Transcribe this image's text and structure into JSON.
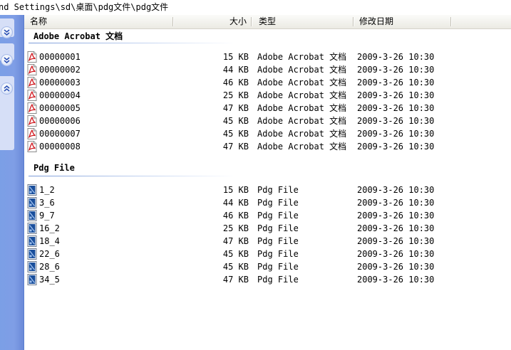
{
  "address": {
    "path": "nd Settings\\sd\\桌面\\pdg文件\\pdg文件"
  },
  "columns": {
    "name": "名称",
    "size": "大小",
    "type": "类型",
    "modified": "修改日期"
  },
  "colors": {
    "sidebar": "#7f9ee6",
    "pdf_icon": "#d0181e",
    "pdg_icon": "#1a4f9c",
    "group_line": "#7a9ad8"
  },
  "groups": [
    {
      "title": "Adobe Acrobat 文档",
      "icon": "pdf-file-icon",
      "files": [
        {
          "name": "00000001",
          "size": "15 KB",
          "type": "Adobe Acrobat 文档",
          "date": "2009-3-26 10:30"
        },
        {
          "name": "00000002",
          "size": "44 KB",
          "type": "Adobe Acrobat 文档",
          "date": "2009-3-26 10:30"
        },
        {
          "name": "00000003",
          "size": "46 KB",
          "type": "Adobe Acrobat 文档",
          "date": "2009-3-26 10:30"
        },
        {
          "name": "00000004",
          "size": "25 KB",
          "type": "Adobe Acrobat 文档",
          "date": "2009-3-26 10:30"
        },
        {
          "name": "00000005",
          "size": "47 KB",
          "type": "Adobe Acrobat 文档",
          "date": "2009-3-26 10:30"
        },
        {
          "name": "00000006",
          "size": "45 KB",
          "type": "Adobe Acrobat 文档",
          "date": "2009-3-26 10:30"
        },
        {
          "name": "00000007",
          "size": "45 KB",
          "type": "Adobe Acrobat 文档",
          "date": "2009-3-26 10:30"
        },
        {
          "name": "00000008",
          "size": "47 KB",
          "type": "Adobe Acrobat 文档",
          "date": "2009-3-26 10:30"
        }
      ]
    },
    {
      "title": "Pdg File",
      "icon": "pdg-file-icon",
      "files": [
        {
          "name": "1_2",
          "size": "15 KB",
          "type": "Pdg File",
          "date": "2009-3-26 10:30"
        },
        {
          "name": "3_6",
          "size": "44 KB",
          "type": "Pdg File",
          "date": "2009-3-26 10:30"
        },
        {
          "name": "9_7",
          "size": "46 KB",
          "type": "Pdg File",
          "date": "2009-3-26 10:30"
        },
        {
          "name": "16_2",
          "size": "25 KB",
          "type": "Pdg File",
          "date": "2009-3-26 10:30"
        },
        {
          "name": "18_4",
          "size": "47 KB",
          "type": "Pdg File",
          "date": "2009-3-26 10:30"
        },
        {
          "name": "22_6",
          "size": "45 KB",
          "type": "Pdg File",
          "date": "2009-3-26 10:30"
        },
        {
          "name": "28_6",
          "size": "45 KB",
          "type": "Pdg File",
          "date": "2009-3-26 10:30"
        },
        {
          "name": "34_5",
          "size": "47 KB",
          "type": "Pdg File",
          "date": "2009-3-26 10:30"
        }
      ]
    }
  ]
}
